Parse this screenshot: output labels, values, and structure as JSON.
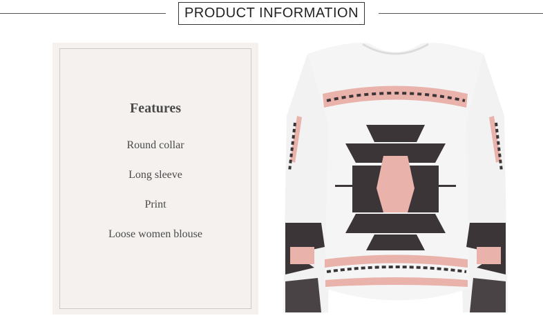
{
  "header": {
    "title": "PRODUCT INFORMATION"
  },
  "features": {
    "title": "Features",
    "items": [
      "Round collar",
      "Long sleeve",
      "Print",
      "Loose women blouse"
    ]
  },
  "product_image": {
    "icon": "blouse-photo",
    "colors": {
      "body": "#f2f2f2",
      "pink": "#e9b2ab",
      "dark": "#3b3538"
    }
  }
}
